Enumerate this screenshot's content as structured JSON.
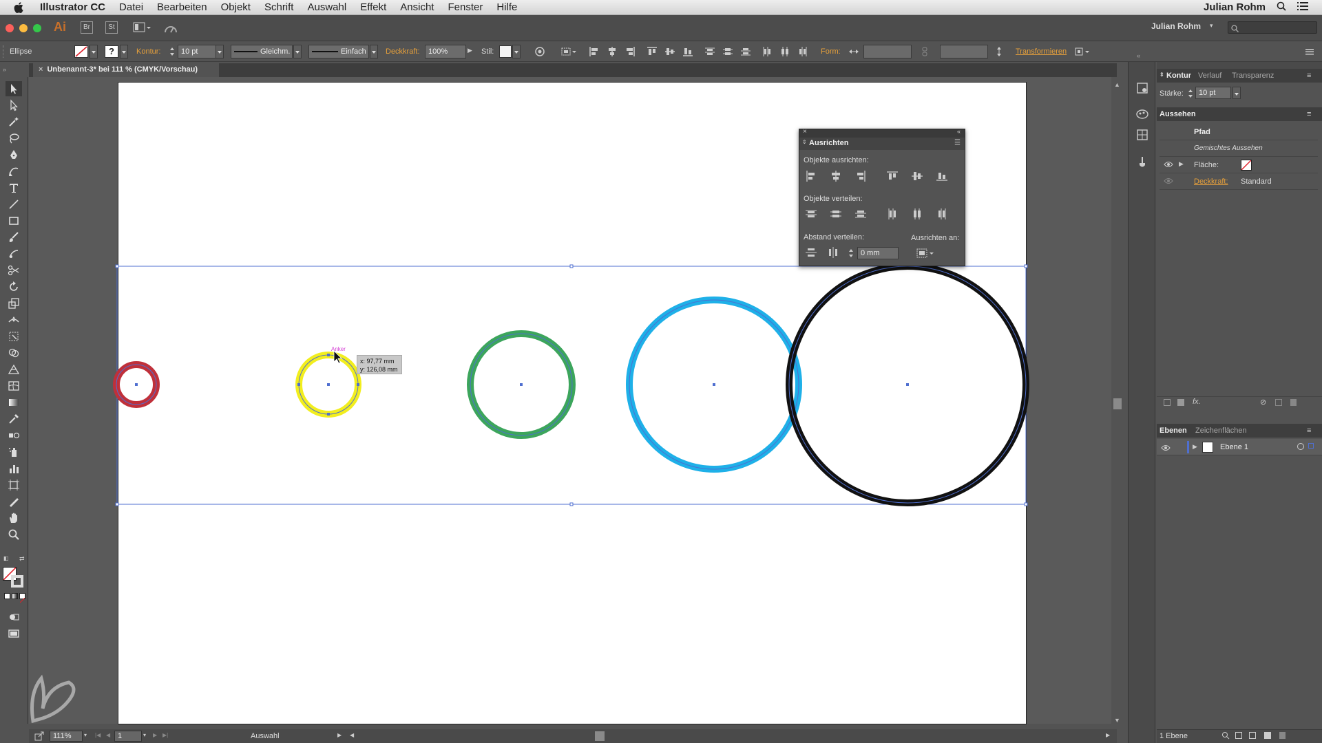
{
  "menubar": {
    "app_name": "Illustrator CC",
    "items": [
      "Datei",
      "Bearbeiten",
      "Objekt",
      "Schrift",
      "Auswahl",
      "Effekt",
      "Ansicht",
      "Fenster",
      "Hilfe"
    ],
    "user": "Julian Rohm"
  },
  "appbar": {
    "logo": "Ai",
    "bridge": "Br",
    "stock": "St",
    "workspace_user": "Julian Rohm",
    "search_placeholder": ""
  },
  "control": {
    "object_type": "Ellipse",
    "stroke_label": "Kontur:",
    "stroke_value": "10 pt",
    "profile": "Gleichm.",
    "brush": "Einfach",
    "opacity_label": "Deckkraft:",
    "opacity_value": "100%",
    "style_label": "Stil:",
    "shape_label": "Form:",
    "transform_label": "Transformieren"
  },
  "document": {
    "tab_title": "Unbenannt-3* bei 111 % (CMYK/Vorschau)"
  },
  "canvas": {
    "tooltip_anchor": "Anker",
    "tooltip_x": "x: 97,77 mm",
    "tooltip_y": "y: 126,08 mm",
    "circles": [
      {
        "name": "red-circle",
        "color": "#c0303a"
      },
      {
        "name": "yellow-circle",
        "color": "#f2ee1e"
      },
      {
        "name": "green-circle",
        "color": "#3ca55c"
      },
      {
        "name": "blue-circle",
        "color": "#1eb0e8"
      },
      {
        "name": "black-circle",
        "color": "#111111"
      }
    ]
  },
  "align_panel": {
    "title": "Ausrichten",
    "objects_align": "Objekte ausrichten:",
    "objects_distribute": "Objekte verteilen:",
    "spacing_distribute": "Abstand verteilen:",
    "align_to": "Ausrichten an:",
    "spacing_value": "0 mm"
  },
  "right_panels": {
    "tabs1": [
      "Kontur",
      "Verlauf",
      "Transparenz"
    ],
    "stroke_weight_label": "Stärke:",
    "stroke_weight_value": "10 pt",
    "appearance_tab": "Aussehen",
    "appearance": {
      "path": "Pfad",
      "mixed": "Gemischtes Aussehen",
      "fill_label": "Fläche:",
      "opacity_label": "Deckkraft:",
      "opacity_value": "Standard"
    },
    "tabs2": [
      "Ebenen",
      "Zeichenflächen"
    ],
    "layer_name": "Ebene 1",
    "layers_count": "1 Ebene"
  },
  "status": {
    "zoom": "111%",
    "page": "1",
    "mode": "Auswahl"
  },
  "colors": {
    "ui_bg": "#535353",
    "accent_orange": "#e8a13b",
    "selection": "#4f6fd0"
  }
}
